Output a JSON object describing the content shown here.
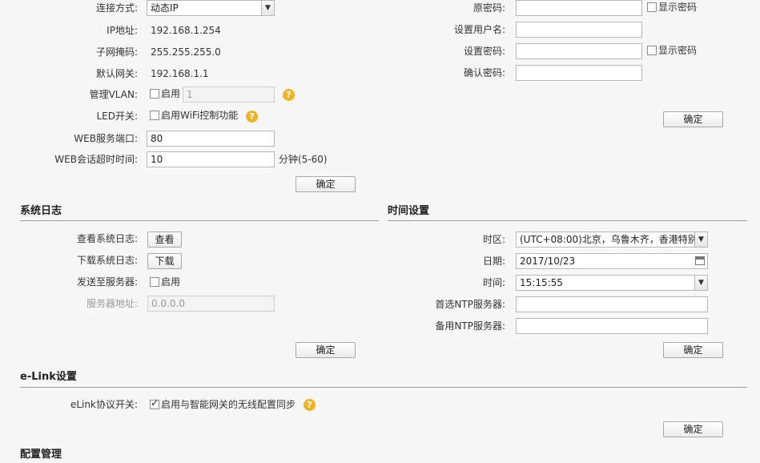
{
  "mgmt": {
    "conn_label": "连接方式:",
    "conn_value": "动态IP",
    "ip_label": "IP地址:",
    "ip_value": "192.168.1.254",
    "mask_label": "子网掩码:",
    "mask_value": "255.255.255.0",
    "gw_label": "默认网关:",
    "gw_value": "192.168.1.1",
    "vlan_label": "管理VLAN:",
    "vlan_enable": "启用",
    "vlan_id": "1",
    "led_label": "LED开关:",
    "led_text": "启用WiFi控制功能",
    "port_label": "WEB服务端口:",
    "port_value": "80",
    "timeout_label": "WEB会话超时时间:",
    "timeout_value": "10",
    "timeout_unit": "分钟(5-60)",
    "confirm": "确定"
  },
  "password": {
    "old_label": "原密码:",
    "user_label": "设置用户名:",
    "new_label": "设置密码:",
    "confirm_label": "确认密码:",
    "show_password": "显示密码",
    "confirm": "确定"
  },
  "syslog": {
    "title": "系统日志",
    "view_label": "查看系统日志:",
    "view_button": "查看",
    "download_label": "下载系统日志:",
    "download_button": "下载",
    "send_label": "发送至服务器:",
    "send_enable": "启用",
    "server_label": "服务器地址:",
    "server_placeholder": "0.0.0.0",
    "confirm": "确定"
  },
  "time": {
    "title": "时间设置",
    "tz_label": "时区:",
    "tz_value": "(UTC+08:00)北京，乌鲁木齐，香港特别",
    "date_label": "日期:",
    "date_value": "2017/10/23",
    "time_label": "时间:",
    "time_value": "15:15:55",
    "ntp1_label": "首选NTP服务器:",
    "ntp2_label": "备用NTP服务器:",
    "confirm": "确定"
  },
  "elink": {
    "title": "e-Link设置",
    "switch_label": "eLink协议开关:",
    "switch_text": "启用与智能网关的无线配置同步",
    "confirm": "确定"
  },
  "next_section": {
    "title": "配置管理"
  },
  "icons": {
    "help": "?",
    "dropdown": "▼"
  },
  "colors": {
    "background": "#f7f7f7",
    "help_icon": "#f2b322",
    "rule": "#9a9a9a"
  }
}
